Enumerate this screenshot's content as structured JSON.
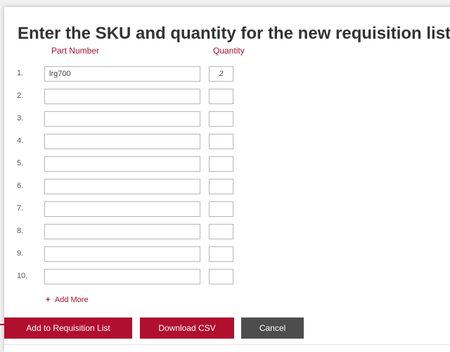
{
  "title": "Enter the SKU and quantity for the new requisition list item",
  "columns": {
    "part_number": "Part Number",
    "quantity": "Quantity"
  },
  "rows": [
    {
      "num": "1.",
      "part": "lrg700",
      "qty": "2"
    },
    {
      "num": "2.",
      "part": "",
      "qty": ""
    },
    {
      "num": "3.",
      "part": "",
      "qty": ""
    },
    {
      "num": "4.",
      "part": "",
      "qty": ""
    },
    {
      "num": "5.",
      "part": "",
      "qty": ""
    },
    {
      "num": "6.",
      "part": "",
      "qty": ""
    },
    {
      "num": "7.",
      "part": "",
      "qty": ""
    },
    {
      "num": "8.",
      "part": "",
      "qty": ""
    },
    {
      "num": "9.",
      "part": "",
      "qty": ""
    },
    {
      "num": "10.",
      "part": "",
      "qty": ""
    }
  ],
  "add_more": {
    "icon": "plus-icon",
    "symbol": "+",
    "label": "Add More"
  },
  "buttons": {
    "add_to_list": "Add to Requisition List",
    "download_csv": "Download CSV",
    "cancel": "Cancel"
  },
  "colors": {
    "accent": "#b10f2e",
    "label_red": "#a8102e",
    "cancel_gray": "#4d4d4d",
    "title_text": "#333333"
  }
}
